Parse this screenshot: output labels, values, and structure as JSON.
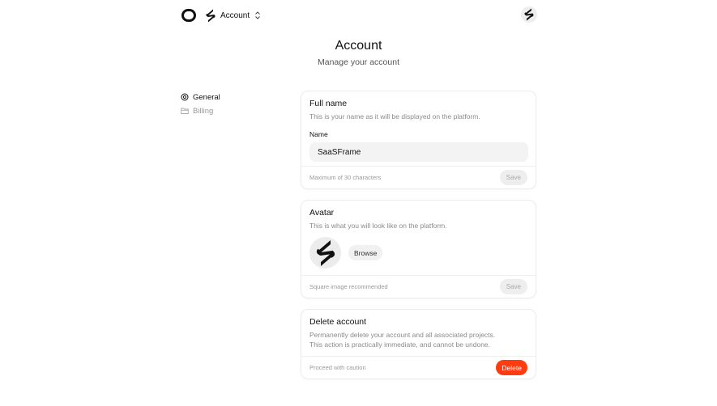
{
  "topbar": {
    "workspace_label": "Account"
  },
  "header": {
    "title": "Account",
    "subtitle": "Manage your account"
  },
  "sidebar": {
    "items": [
      {
        "label": "General",
        "icon": "gear-icon",
        "active": true
      },
      {
        "label": "Billing",
        "icon": "folder-icon",
        "active": false
      }
    ]
  },
  "cards": {
    "full_name": {
      "title": "Full name",
      "description": "This is your name as it will be displayed on the platform.",
      "field_label": "Name",
      "value": "SaaSFrame",
      "footer_note": "Maximum of 30 characters",
      "save_label": "Save"
    },
    "avatar": {
      "title": "Avatar",
      "description": "This is what you will look like on the platform.",
      "browse_label": "Browse",
      "footer_note": "Square image recommended",
      "save_label": "Save"
    },
    "delete_account": {
      "title": "Delete account",
      "description_line1": "Permanently delete your account and all associated projects.",
      "description_line2": "This action is practically immediate, and cannot be undone.",
      "footer_note": "Proceed with caution",
      "delete_label": "Delete"
    }
  },
  "colors": {
    "accent_danger": "#ff3b12",
    "muted_text": "#8a8a8a",
    "input_bg": "#f3f3f3"
  }
}
